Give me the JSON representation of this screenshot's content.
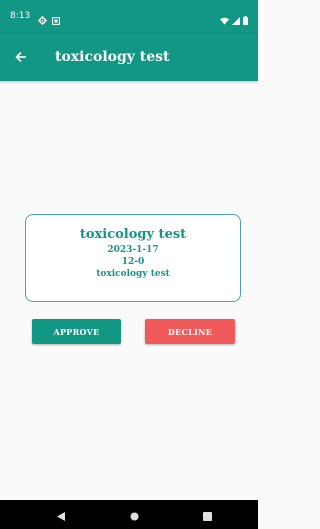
{
  "status_bar": {
    "time": "8:13",
    "left_icons": [
      "settings-icon",
      "notification-icon"
    ],
    "right_icons": [
      "wifi-icon",
      "signal-icon",
      "battery-icon"
    ]
  },
  "app_bar": {
    "title": "toxicology test",
    "back_icon": "arrow-left-icon",
    "color": "#139785"
  },
  "card": {
    "title": "toxicology test",
    "date": "2023-1-17",
    "score": "12-0",
    "subtitle": "toxicology test",
    "border_color": "#4aa79a"
  },
  "actions": {
    "approve_label": "APPROVE",
    "decline_label": "DECLINE",
    "approve_color": "#139785",
    "decline_color": "#f05a5a"
  },
  "nav_bar": {
    "icons": [
      "back-triangle-icon",
      "home-circle-icon",
      "recents-square-icon"
    ]
  }
}
